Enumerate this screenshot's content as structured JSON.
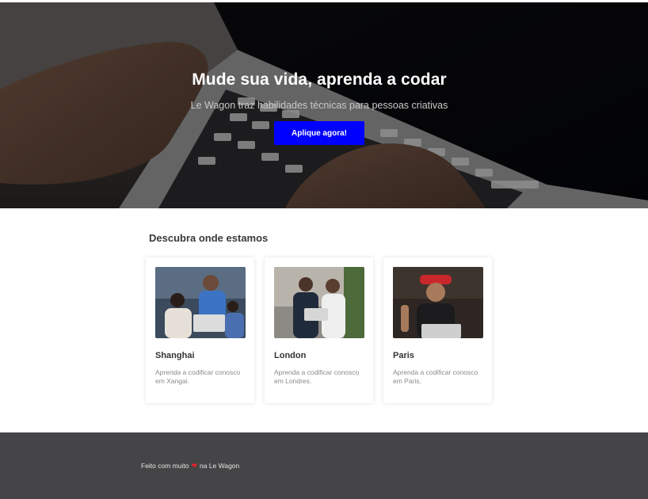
{
  "hero": {
    "title": "Mude sua vida, aprenda a codar",
    "subtitle": "Le Wagon traz habilidades técnicas para pessoas criativas",
    "button_label": "Aplique agora!"
  },
  "locations": {
    "heading": "Descubra onde estamos",
    "cards": [
      {
        "city": "Shanghai",
        "description": "Aprenda a codificar conosco em Xangai."
      },
      {
        "city": "London",
        "description": "Aprenda a codificar conosco em Londres."
      },
      {
        "city": "Paris",
        "description": "Aprenda a codificar conosco em Paris."
      }
    ]
  },
  "footer": {
    "prefix": "Feito com muito",
    "suffix": "na Le Wagon",
    "icon": "heart-icon"
  },
  "colors": {
    "button": "#0000ff",
    "footer_bg": "#454547",
    "heart": "#e0242d"
  }
}
